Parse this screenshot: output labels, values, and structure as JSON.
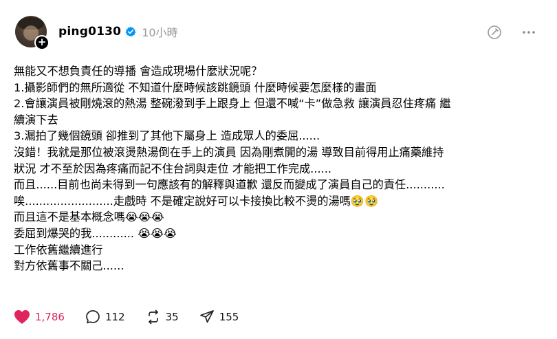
{
  "post": {
    "username": "ping0130",
    "time": "10小時",
    "lines": [
      "無能又不想負責任的導播 會造成現場什麼狀況呢？",
      "1.攝影師們的無所適從 不知道什麼時候該跳鏡頭 什麼時候要怎麼樣的畫面",
      "2.會讓演員被剛燒滾的熱湯 整碗潑到手上跟身上 但還不喊“卡”做急救 讓演員忍住疼痛 繼",
      "續演下去",
      "3.漏拍了幾個鏡頭 卻推到了其他下屬身上 造成眾人的委屈......",
      "沒錯！我就是那位被滾燙熱湯倒在手上的演員 因為剛煮開的湯 導致目前得用止痛藥維持",
      "狀況 才不至於因為疼痛而記不住台詞與走位 才能把工作完成......",
      "而且......目前也尚未得到一句應該有的解釋與道歉 還反而變成了演員自己的責任...........",
      "唉.........................走戲時 不是確定說好可以卡接換比較不燙的湯嗎🥹🥹",
      "而且這不是基本概念嗎😭😭😭",
      "委屈到爆哭的我............ 😭😭😭",
      "工作依舊繼續進行",
      "對方依舊事不關己......"
    ]
  },
  "actions": {
    "likes": "1,786",
    "comments": "112",
    "reposts": "35",
    "shares": "155"
  },
  "colors": {
    "like": "#e0245e",
    "verified": "#0095f6",
    "muted": "#999999"
  },
  "icons": [
    "avatar",
    "follow-plus-icon",
    "verified-badge-icon",
    "edit-icon",
    "more-options-icon",
    "heart-icon",
    "comment-icon",
    "repost-icon",
    "share-icon"
  ]
}
